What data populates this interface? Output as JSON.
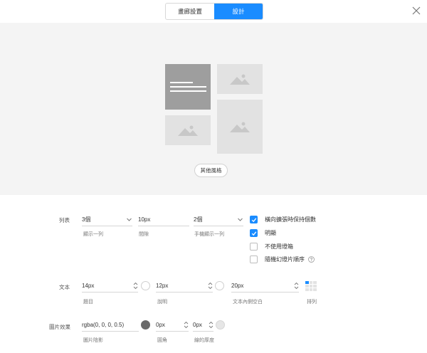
{
  "tabs": {
    "style_label": "畫廊設置",
    "design_label": "設計",
    "active": "design"
  },
  "preview": {
    "other_styles_label": "其他風格"
  },
  "columns": {
    "row_label": "列表",
    "per_row": {
      "value": "3個",
      "label": "顯示一列"
    },
    "spacing": {
      "value": "10px",
      "label": "間隙"
    },
    "mobile_per_row": {
      "value": "2個",
      "label": "手機顯示一列"
    }
  },
  "options": {
    "keep_count": {
      "label": "橫向擴張時保持個數",
      "checked": true
    },
    "bright": {
      "label": "明顯",
      "checked": true
    },
    "no_lightbox": {
      "label": "不使用燈箱",
      "checked": false
    },
    "random_order": {
      "label": "隨機幻燈片順序",
      "checked": false
    }
  },
  "text": {
    "row_label": "文本",
    "title_size": {
      "value": "14px",
      "label": "題目"
    },
    "desc_size": {
      "value": "12px",
      "label": "說明"
    },
    "padding": {
      "value": "20px",
      "label": "文本內側空白"
    },
    "align_label": "排列"
  },
  "image_effect": {
    "row_label": "圖片效果",
    "shadow": {
      "value": "rgba(0, 0, 0, 0.5)",
      "label": "圖片陰影"
    },
    "radius": {
      "value": "0px",
      "label": "圓角"
    },
    "border": {
      "value": "0px",
      "label": "線的厚度"
    }
  },
  "colors": {
    "accent": "#1a8cff",
    "preview_bg": "#f4f4f4",
    "shadow_swatch": "#6a6a6a"
  },
  "icons": [
    "close-icon",
    "chevron-down-icon",
    "stepper-icon",
    "check-icon",
    "help-icon",
    "mountain-image-icon"
  ]
}
